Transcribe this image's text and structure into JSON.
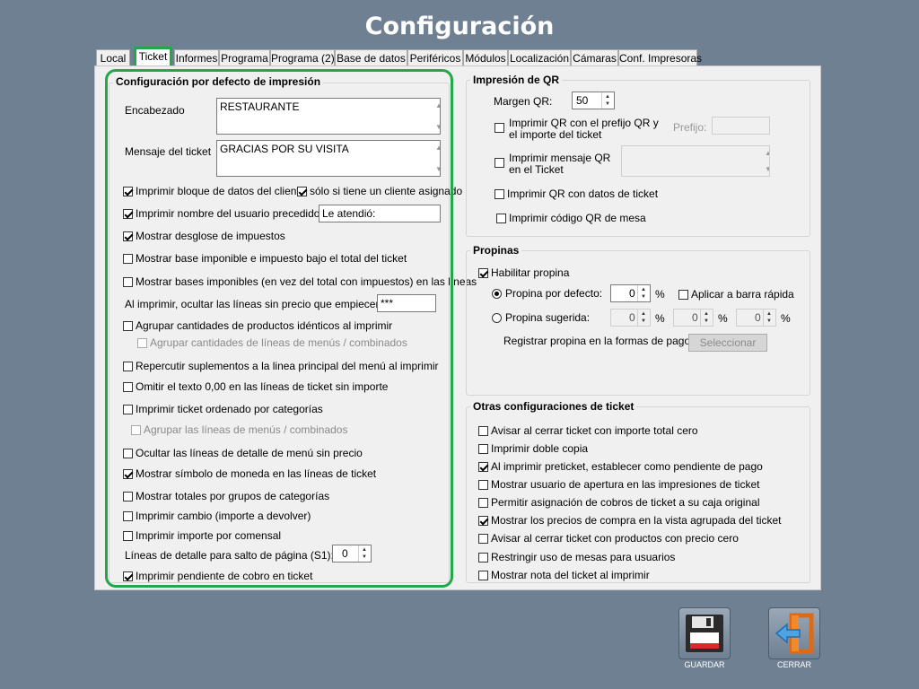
{
  "window": {
    "title": "Configuración"
  },
  "tabs": [
    "Local",
    "Ticket",
    "Informes",
    "Programa",
    "Programa (2)",
    "Base de datos",
    "Periféricos",
    "Módulos",
    "Localización",
    "Cámaras",
    "Conf. Impresoras"
  ],
  "active_tab": "Ticket",
  "print_defaults": {
    "title": "Configuración por defecto de impresión",
    "header_label": "Encabezado",
    "header_value": "RESTAURANTE",
    "message_label": "Mensaje del ticket",
    "message_value": "GRACIAS POR SU VISITA",
    "items": [
      {
        "label": "Imprimir bloque de datos del cliente",
        "checked": true
      },
      {
        "label": "sólo si tiene un cliente asignado",
        "checked": true
      },
      {
        "label": "Imprimir nombre del usuario precedido de:",
        "checked": true
      },
      {
        "label": "Mostrar desglose de impuestos",
        "checked": true
      },
      {
        "label": "Mostrar base imponible e impuesto bajo el total del ticket",
        "checked": false
      },
      {
        "label": "Mostrar bases imponibles (en vez del total con impuestos) en las líneas",
        "checked": false
      },
      {
        "label": "Agrupar cantidades de productos idénticos al imprimir",
        "checked": false
      },
      {
        "label": "Agrupar cantidades de líneas de menús / combinados",
        "checked": false
      },
      {
        "label": "Repercutir suplementos a la linea principal del menú al imprimir",
        "checked": false
      },
      {
        "label": "Omitir el texto 0,00 en las líneas de ticket sin importe",
        "checked": false
      },
      {
        "label": "Imprimir ticket ordenado por categorías",
        "checked": false
      },
      {
        "label": "Agrupar las líneas de menús / combinados",
        "checked": false
      },
      {
        "label": "Ocultar las líneas de detalle de menú sin precio",
        "checked": false
      },
      {
        "label": "Mostrar símbolo de moneda en las líneas de ticket",
        "checked": true
      },
      {
        "label": "Mostrar totales por grupos de categorías",
        "checked": false
      },
      {
        "label": "Imprimir cambio (importe a devolver)",
        "checked": false
      },
      {
        "label": "Imprimir importe por comensal",
        "checked": false
      },
      {
        "label": "Imprimir pendiente de cobro en ticket",
        "checked": true
      }
    ],
    "user_prefix_value": "Le atendió:",
    "hide_lines_label": "Al imprimir, ocultar las líneas sin precio que empiecen por:",
    "hide_lines_value": "***",
    "lines_break_label": "Líneas de detalle para salto de página (S1):",
    "lines_break_value": "0"
  },
  "qr": {
    "title": "Impresión de QR",
    "margin_label": "Margen QR:",
    "margin_value": "50",
    "prefix_check": {
      "label": "Imprimir QR con el prefijo QR y el importe del ticket",
      "checked": false
    },
    "prefix_label": "Prefijo:",
    "message_check": {
      "label": "Imprimir mensaje QR en el Ticket",
      "checked": false
    },
    "data_check": {
      "label": "Imprimir QR con datos de ticket",
      "checked": false
    },
    "table_check": {
      "label": "Imprimir código QR de mesa",
      "checked": false
    }
  },
  "tips": {
    "title": "Propinas",
    "enable": {
      "label": "Habilitar propina",
      "checked": true
    },
    "default_radio": {
      "label": "Propina por defecto:",
      "selected": true
    },
    "default_value": "0",
    "percent": "%",
    "quick_bar": {
      "label": "Aplicar a barra rápida",
      "checked": false
    },
    "suggested_radio": {
      "label": "Propina sugerida:",
      "selected": false
    },
    "suggested_values": [
      "0",
      "0",
      "0"
    ],
    "register_label": "Registrar propina en la formas de pago:",
    "select_button": "Seleccionar"
  },
  "other": {
    "title": "Otras configuraciones de ticket",
    "items": [
      {
        "label": "Avisar al cerrar ticket con importe total cero",
        "checked": false
      },
      {
        "label": "Imprimir doble copia",
        "checked": false
      },
      {
        "label": "Al imprimir preticket, establecer como pendiente de pago",
        "checked": true
      },
      {
        "label": "Mostrar usuario de apertura en las impresiones de ticket",
        "checked": false
      },
      {
        "label": "Permitir asignación de cobros de ticket a su caja original",
        "checked": false
      },
      {
        "label": "Mostrar los precios de compra en la vista agrupada del ticket",
        "checked": true
      },
      {
        "label": "Avisar al cerrar ticket con productos con precio cero",
        "checked": false
      },
      {
        "label": "Restringir uso de mesas para usuarios",
        "checked": false
      },
      {
        "label": "Mostrar nota del ticket al imprimir",
        "checked": false
      }
    ]
  },
  "actions": {
    "save_label": "GUARDAR",
    "close_label": "CERRAR"
  },
  "colors": {
    "background": "#6f8093",
    "highlight": "#22a84a",
    "panel": "#f0f0f0"
  }
}
